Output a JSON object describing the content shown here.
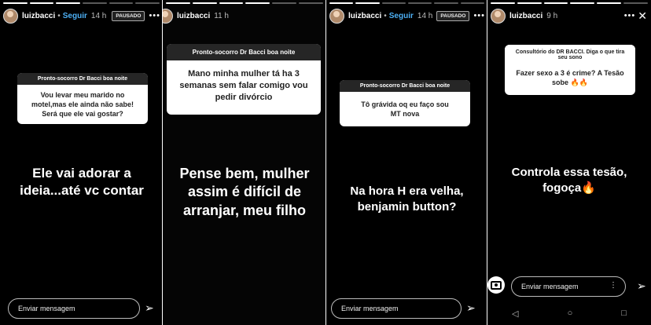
{
  "stories": [
    {
      "username": "luizbacci",
      "time": "14 h",
      "follow": "Seguir",
      "paused": "PAUSADO",
      "question_title": "Pronto-socorro Dr Bacci boa noite",
      "question_text": "Vou levar meu marido no motel,mas ele ainda não sabe! Será que ele vai gostar?",
      "answer": "Ele vai adorar a ideia...até vc contar",
      "send_placeholder": "Enviar mensagem"
    },
    {
      "username": "luizbacci",
      "time": "11 h",
      "question_title": "Pronto-socorro Dr Bacci boa noite",
      "question_text": "Mano minha mulher tá ha 3 semanas sem falar comigo vou pedir divórcio",
      "answer": "Pense bem, mulher assim é difícil de arranjar, meu filho"
    },
    {
      "username": "luizbacci",
      "time": "14 h",
      "follow": "Seguir",
      "paused": "PAUSADO",
      "question_title": "Pronto-socorro Dr Bacci boa noite",
      "question_text": "Tô grávida oq eu faço sou MT nova",
      "answer": "Na hora H era velha, benjamin button?",
      "send_placeholder": "Enviar mensagem"
    },
    {
      "username": "luizbacci",
      "time": "9 h",
      "question_title": "Consultório do DR BACCI. Diga o que tira seu sono",
      "question_text": "Fazer sexo a 3 é crime? A Tesão sobe 🔥🔥",
      "answer": "Controla essa tesão, fogoça🔥",
      "send_placeholder": "Enviar mensagem"
    }
  ],
  "icons": {
    "more": "more-options-icon",
    "close": "close-icon",
    "send": "send-icon",
    "camera": "camera-icon"
  }
}
